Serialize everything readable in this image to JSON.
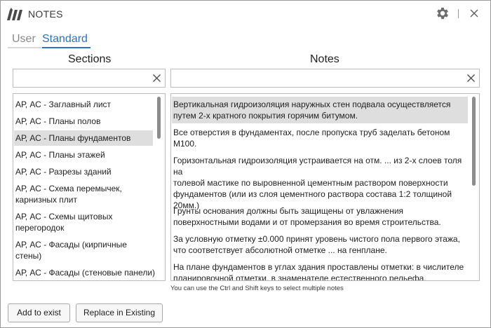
{
  "window": {
    "title": "NOTES"
  },
  "tabs": [
    {
      "label": "User",
      "active": false
    },
    {
      "label": "Standard",
      "active": true
    }
  ],
  "headers": {
    "sections": "Sections",
    "notes": "Notes"
  },
  "search": {
    "sections": {
      "value": "",
      "placeholder": ""
    },
    "notes": {
      "value": "",
      "placeholder": ""
    }
  },
  "sections": {
    "selected_index": 2,
    "items": [
      {
        "lines": [
          "АР, АС - Заглавный лист"
        ]
      },
      {
        "lines": [
          "АР, АС - Планы полов"
        ]
      },
      {
        "lines": [
          "АР, АС - Планы фундаментов"
        ]
      },
      {
        "lines": [
          "АР, АС - Планы этажей"
        ]
      },
      {
        "lines": [
          "АР, АС - Разрезы зданий"
        ]
      },
      {
        "lines": [
          "АР, АС - Схема перемычек,",
          "карнизных плит"
        ]
      },
      {
        "lines": [
          "АР, АС - Схемы щитовых",
          "перегородок"
        ]
      },
      {
        "lines": [
          "АР, АС - Фасады (кирпичные",
          "стены)"
        ]
      },
      {
        "lines": [
          "АР, АС - Фасады (стеновые панели)"
        ]
      }
    ]
  },
  "notes": {
    "selected_index": 0,
    "items": [
      {
        "lines": [
          "Вертикальная гидроизоляция наружных стен подвала осуществляется",
          "путем 2-х кратного покрытия горячим битумом."
        ]
      },
      {
        "lines": [
          "Все отверстия в фундаментах, после пропуска труб заделать бетоном",
          "М100."
        ]
      },
      {
        "lines": [
          "Горизонтальная гидроизоляция устраивается на отм. ... из 2-х слоев толя на",
          "толевой мастике по выровненной цементным раствором поверхности",
          "фундаментов (или из слоя цементного раствора состава 1:2 толщиной",
          "20мм.)"
        ]
      },
      {
        "lines": [
          "Грунты основания должны быть защищены от увлажнения",
          "поверхностными водами и от промерзания во время строительства."
        ]
      },
      {
        "lines": [
          "За условную отметку ±0.000 принят уровень чистого пола первого этажа,",
          "что соответствует абсолютной отметке ... на генплане."
        ]
      },
      {
        "lines": [
          "На плане фундаментов в углах здания проставлены отметки: в числителе",
          "планировочной отметки, в знаменателе естественного рельефа."
        ]
      }
    ]
  },
  "hint": "You can use the Ctrl and Shift keys to select multiple notes",
  "buttons": {
    "add": "Add to exist",
    "replace": "Replace in Existing"
  },
  "icons": {
    "logo": "logo-icon",
    "settings": "gear-icon",
    "close": "close-icon",
    "clear": "clear-icon"
  },
  "colors": {
    "accent": "#2a72c2",
    "selection": "#dedede",
    "text": "#1f1f1f"
  }
}
